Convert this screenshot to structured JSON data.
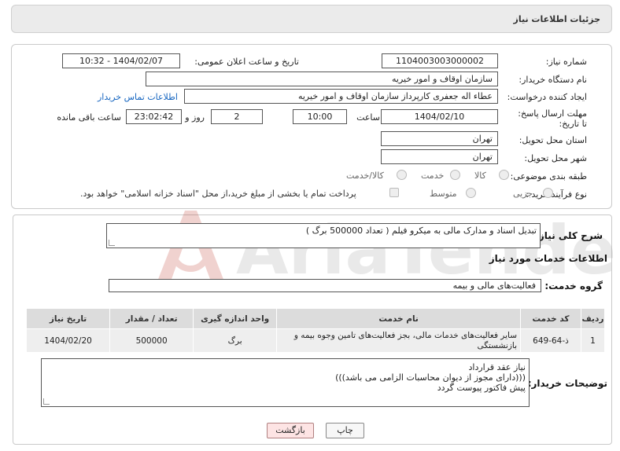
{
  "page_title": "جزئیات اطلاعات نیاز",
  "fields": {
    "need_number_label": "شماره نیاز:",
    "need_number": "1104003003000002",
    "announce_label": "تاریخ و ساعت اعلان عمومی:",
    "announce_value": "1404/02/07 - 10:32",
    "buyer_org_label": "نام دستگاه خریدار:",
    "buyer_org": "سازمان اوقاف و امور خیریه",
    "creator_label": "ایجاد کننده درخواست:",
    "creator": "عطاء اله جعفری کارپرداز سازمان اوقاف و امور خیریه",
    "contact_link": "اطلاعات تماس خریدار",
    "deadline_label": "مهلت ارسال پاسخ: تا تاریخ:",
    "deadline_date": "1404/02/10",
    "time_label": "ساعت",
    "deadline_time": "10:00",
    "days_value": "2",
    "days_label": "روز و",
    "remaining_time": "23:02:42",
    "remaining_label": "ساعت باقی مانده",
    "province_label": "استان محل تحویل:",
    "province": "تهران",
    "city_label": "شهر محل تحویل:",
    "city": "تهران",
    "category_label": "طبقه بندی موضوعی:",
    "category_options": [
      "کالا",
      "خدمت",
      "کالا/خدمت"
    ],
    "process_label": "نوع فرآیند خرید :",
    "process_options": [
      "جزیی",
      "متوسط"
    ],
    "payment_note": "پرداخت تمام یا بخشی از مبلغ خرید،از محل \"اسناد خزانه اسلامی\" خواهد بود."
  },
  "summary": {
    "label": "شرح کلی نیاز:",
    "value": "تبدیل اسناد و مدارک مالی به میکرو فیلم (  تعداد 500000 برگ )"
  },
  "services": {
    "header": "اطلاعات خدمات مورد نیاز",
    "group_label": "گروه خدمت:",
    "group_value": "فعالیت‌های مالی و بیمه",
    "columns": [
      "ردیف",
      "کد خدمت",
      "نام خدمت",
      "واحد اندازه گیری",
      "تعداد / مقدار",
      "تاریخ نیاز"
    ],
    "rows": [
      {
        "index": "1",
        "code": "ذ-64-649",
        "name": "سایر فعالیت‌های خدمات مالی، بجز فعالیت‌های تامین وجوه بیمه و بازنشستگی",
        "unit": "برگ",
        "qty": "500000",
        "date": "1404/02/20"
      }
    ]
  },
  "buyer_notes": {
    "label": "توضیحات خریدار:",
    "lines": [
      "نیاز عقد قرارداد",
      "(((دارای مجوز از دیوان محاسبات الزامی می باشد)))",
      "پیش فاکتور پیوست گردد"
    ]
  },
  "buttons": {
    "print": "چاپ",
    "back": "بازگشت"
  },
  "watermark_text": "AriaTender.neT"
}
